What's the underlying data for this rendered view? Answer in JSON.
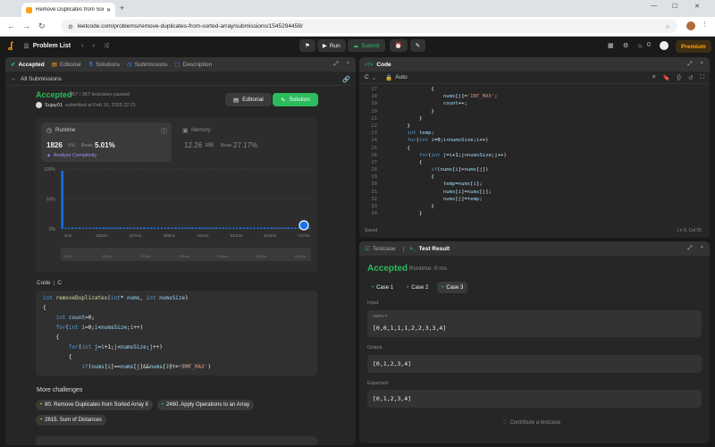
{
  "browser": {
    "tab_title": "Remove Duplicates from Sorted...",
    "url": "leetcode.com/problems/remove-duplicates-from-sorted-array/submissions/1545294458/"
  },
  "nav": {
    "problem_list": "Problem List",
    "run": "Run",
    "submit": "Submit",
    "premium": "Premium",
    "count": "0"
  },
  "left_tabs": [
    "Accepted",
    "Editorial",
    "Solutions",
    "Submissions",
    "Description"
  ],
  "submission": {
    "back": "All Submissions",
    "status": "Accepted",
    "testcases": "367 / 367 testcases passed",
    "user": "Sujay01",
    "submitted": "submitted at Feb 16, 2025 22:21",
    "editorial_btn": "Editorial",
    "solution_btn": "Solution",
    "runtime_label": "Runtime",
    "runtime_value": "1826",
    "runtime_unit": "ms",
    "beats_label": "Beats",
    "runtime_beats": "5.01%",
    "analyze": "Analyze Complexity",
    "memory_label": "Memory",
    "memory_value": "12.26",
    "memory_unit": "MB",
    "memory_beats": "27.17%"
  },
  "chart_data": {
    "type": "bar",
    "y_ticks": [
      "100%",
      "50%",
      "0%"
    ],
    "x_ticks": [
      "4ms",
      "105ms",
      "207ms",
      "309ms",
      "411ms",
      "513ms",
      "614ms",
      "717ms"
    ],
    "mini_ticks": [
      "0ms",
      "102ms",
      "203ms",
      "304ms",
      "406ms",
      "508ms",
      "610ms"
    ],
    "bins": 73,
    "values": [
      97,
      2,
      1,
      1,
      1,
      1,
      1,
      1,
      1,
      1,
      1,
      1,
      1,
      1,
      1,
      1,
      1,
      1,
      1,
      1,
      1,
      1,
      1,
      1,
      1,
      1,
      1,
      1,
      1,
      1,
      1,
      1,
      1,
      1,
      1,
      1,
      1,
      1,
      1,
      1,
      1,
      1,
      1,
      1,
      1,
      1,
      1,
      1,
      1,
      1,
      1,
      1,
      1,
      1,
      1,
      1,
      1,
      1,
      1,
      1,
      1,
      1,
      1,
      1,
      1,
      1,
      1,
      1,
      1,
      1,
      1,
      1,
      1
    ],
    "ylim": [
      0,
      100
    ]
  },
  "left_code": {
    "label": "Code",
    "lang": "C",
    "view_more": "View more",
    "lines": [
      "int removeDuplicates(int* nums, int numsSize)",
      "{",
      "    int count=0;",
      "    for(int i=0;i<numsSize;i++)",
      "    {",
      "        for(int j=i+1;j<numsSize;j++)",
      "        {",
      "            if(nums[i]==nums[j]&&nums[i]!='INT_MAX')"
    ]
  },
  "challenges": {
    "title": "More challenges",
    "items": [
      "80. Remove Duplicates from Sorted Array II",
      "2460. Apply Operations to an Array",
      "2615. Sum of Distances"
    ]
  },
  "editor": {
    "title": "Code",
    "lang": "C",
    "mode": "Auto",
    "saved": "Saved",
    "cursor": "Ln 8, Col 55",
    "line_numbers": [
      "17",
      "18",
      "19",
      "20",
      "21",
      "22",
      "23",
      "24",
      "25",
      "26",
      "27",
      "28",
      "29",
      "30",
      "31",
      "32",
      "33",
      "34"
    ],
    "lines": [
      "            {",
      "                nums[j]='INT_MAX';",
      "                count++;",
      "            }",
      "        }",
      "    }",
      "    int temp;",
      "    for(int i=0;i<numsSize;i++)",
      "    {",
      "        for(int j=i+1;j<numsSize;j++)",
      "        {",
      "            if(nums[i]>nums[j])",
      "            {",
      "                temp=nums[i];",
      "                nums[i]=nums[j];",
      "                nums[j]=temp;",
      "            }",
      "        }"
    ]
  },
  "testpanel": {
    "tab_testcase": "Testcase",
    "tab_result": "Test Result",
    "status": "Accepted",
    "runtime": "Runtime: 0 ms",
    "cases": [
      "Case 1",
      "Case 2",
      "Case 3"
    ],
    "input_label": "Input",
    "var_name": "nums =",
    "input_value": "[0,0,1,1,1,2,2,3,3,4]",
    "output_label": "Output",
    "output_value": "[0,1,2,3,4]",
    "expected_label": "Expected",
    "expected_value": "[0,1,2,3,4]",
    "contribute": "Contribute a testcase"
  },
  "colors": {
    "accent": "#2cbb5d",
    "chart_bar": "#1a73e8",
    "premium": "#ffa116"
  }
}
